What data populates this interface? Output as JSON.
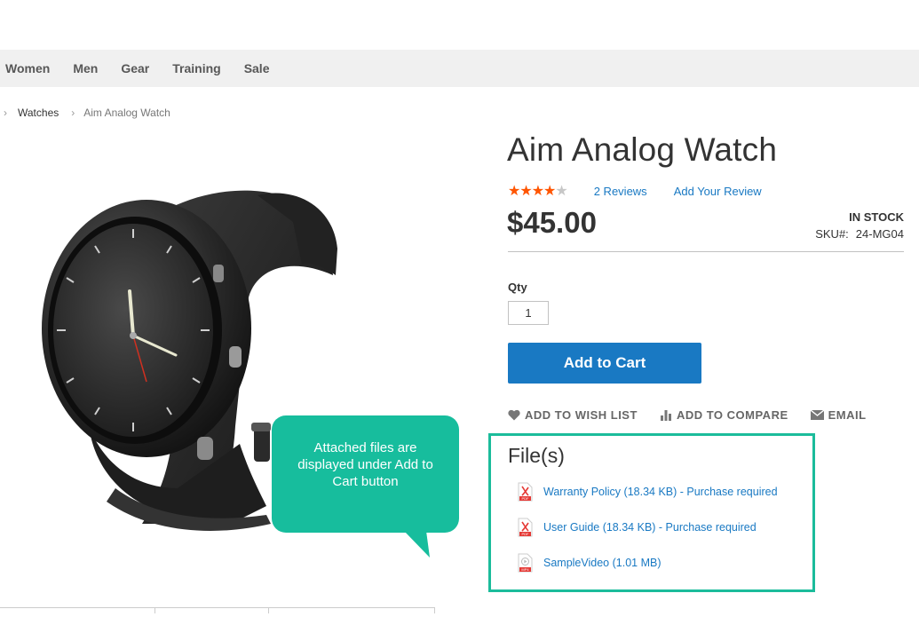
{
  "nav": {
    "items": [
      "Women",
      "Men",
      "Gear",
      "Training",
      "Sale"
    ]
  },
  "breadcrumb": {
    "items": [
      "Watches",
      "Aim Analog Watch"
    ]
  },
  "product": {
    "title": "Aim Analog Watch",
    "rating": 4,
    "rating_max": 5,
    "reviews_link": "2 Reviews",
    "add_review_link": "Add Your Review",
    "price": "$45.00",
    "stock": "IN STOCK",
    "sku_label": "SKU#:",
    "sku_value": "24-MG04"
  },
  "form": {
    "qty_label": "Qty",
    "qty_value": "1",
    "add_to_cart": "Add to Cart"
  },
  "actions": {
    "wishlist": "ADD TO WISH LIST",
    "compare": "ADD TO COMPARE",
    "email": "EMAIL"
  },
  "files": {
    "title": "File(s)",
    "items": [
      {
        "label": "Warranty Policy (18.34 KB) - Purchase required",
        "icon": "pdf-file-icon"
      },
      {
        "label": "User Guide (18.34 KB) - Purchase required",
        "icon": "pdf-file-icon"
      },
      {
        "label": "SampleVideo (1.01 MB)",
        "icon": "mp4-file-icon"
      }
    ]
  },
  "callout": {
    "text": "Attached files are displayed under Add to Cart button"
  },
  "colors": {
    "accent": "#1979c3",
    "callout": "#17bd9d",
    "star": "#ff5501"
  }
}
